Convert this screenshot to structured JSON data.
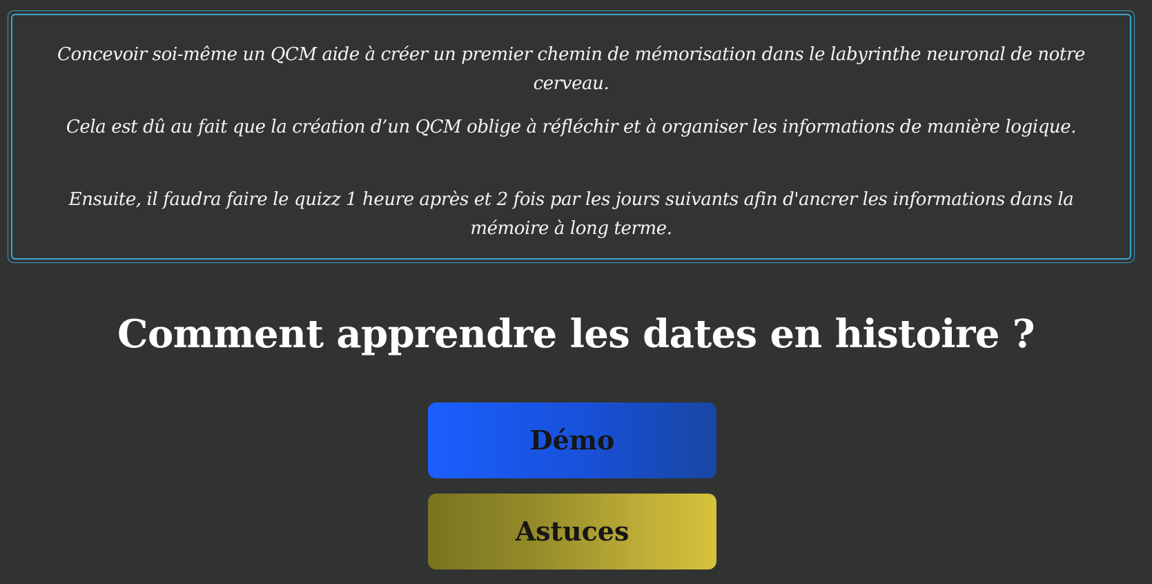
{
  "info_box": {
    "paragraphs": [
      "Concevoir soi-même un QCM aide à créer un premier chemin de mémorisation dans le labyrinthe neuronal de notre cerveau.",
      "Cela est dû au fait que la création d’un QCM oblige à réfléchir et à organiser les informations de manière logique.",
      "Ensuite, il faudra faire le quizz 1 heure après et 2 fois par les jours suivants afin d'ancrer les informations dans la mémoire à long terme."
    ]
  },
  "page": {
    "title": "Comment apprendre les dates en histoire ?"
  },
  "buttons": {
    "demo_label": "Démo",
    "tips_label": "Astuces"
  },
  "colors": {
    "background": "#313332",
    "border_accent": "#3ea4cc",
    "demo_gradient_start": "#1b5ffe",
    "demo_gradient_end": "#1847a3",
    "tips_gradient_start": "#7a7420",
    "tips_gradient_end": "#d6c23b"
  }
}
